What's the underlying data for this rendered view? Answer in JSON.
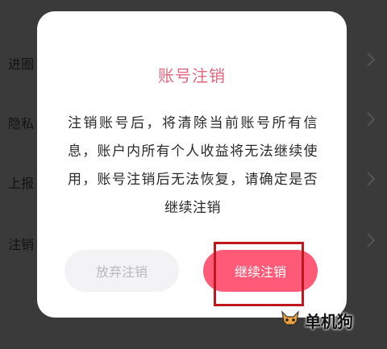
{
  "background": {
    "rows": [
      {
        "label": "进圈"
      },
      {
        "label": "隐私"
      },
      {
        "label": "上报"
      },
      {
        "label": "注销"
      }
    ]
  },
  "dialog": {
    "title": "账号注销",
    "body": "注销账号后，将清除当前账号所有信息，账户内所有个人收益将无法继续使用，账号注销后无法恢复，请确定是否继续注销",
    "cancel_label": "放弃注销",
    "continue_label": "继续注销"
  },
  "colors": {
    "title": "#e0677e",
    "primary_button": "#ff5b78",
    "secondary_button": "#f3f3f5",
    "highlight": "#c0161d"
  },
  "watermark": {
    "text": "单机狗"
  }
}
